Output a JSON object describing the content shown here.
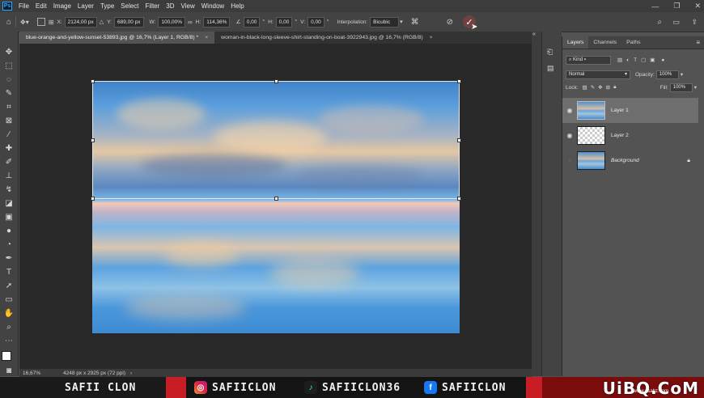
{
  "menu": {
    "app_icon": "Ps",
    "items": [
      "File",
      "Edit",
      "Image",
      "Layer",
      "Type",
      "Select",
      "Filter",
      "3D",
      "View",
      "Window",
      "Help"
    ],
    "window_controls": [
      "—",
      "❐",
      "✕"
    ]
  },
  "options": {
    "x_label": "X:",
    "x_value": "2124,00 px",
    "y_label": "Y:",
    "y_value": "689,00 px",
    "w_label": "W:",
    "w_value": "100,00%",
    "h_label": "H:",
    "h_value": "114,36%",
    "angle_value": "0,00",
    "hskew_label": "H:",
    "hskew_value": "0,00",
    "vskew_label": "V:",
    "vskew_value": "0,00",
    "interp_label": "Interpolation:",
    "interp_value": "Bicubic",
    "deg_symbol": "°"
  },
  "tabs": [
    {
      "label": "blue-orange-and-yellow-sunset-53893.jpg @ 16,7% (Layer 1, RGB/8) *",
      "close": "×"
    },
    {
      "label": "woman-in-black-long-sleeve-shirt-standing-on-boat-3922943.jpg @ 16,7% (RGB/8)",
      "close": "×"
    }
  ],
  "status": {
    "zoom": "16,67%",
    "doc_info": "4248 px x 2925 px (72 ppi)"
  },
  "panel": {
    "tabs": [
      "Layers",
      "Channels",
      "Paths"
    ],
    "filter_placeholder": "Kind",
    "blend_mode": "Normal",
    "opacity_label": "Opacity:",
    "opacity_value": "100%",
    "lock_label": "Lock:",
    "fill_label": "Fill:",
    "fill_value": "100%",
    "layers": [
      {
        "name": "Layer 1",
        "visible": true,
        "selected": true
      },
      {
        "name": "Layer 2",
        "visible": true,
        "selected": false
      },
      {
        "name": "Background",
        "visible": false,
        "selected": false,
        "locked": true
      }
    ]
  },
  "footer": {
    "left_name": "SAFII CLON",
    "instagram": "SAFIICLON",
    "tiktok": "SAFIICLON36",
    "facebook": "SAFIICLON",
    "watermark": "UiBQ.CoM",
    "watermark_sub": "www.psahz.com"
  },
  "colors": {
    "accent": "#31a8ff",
    "banner_red": "#b3151b",
    "canvas_bg": "#282828"
  }
}
